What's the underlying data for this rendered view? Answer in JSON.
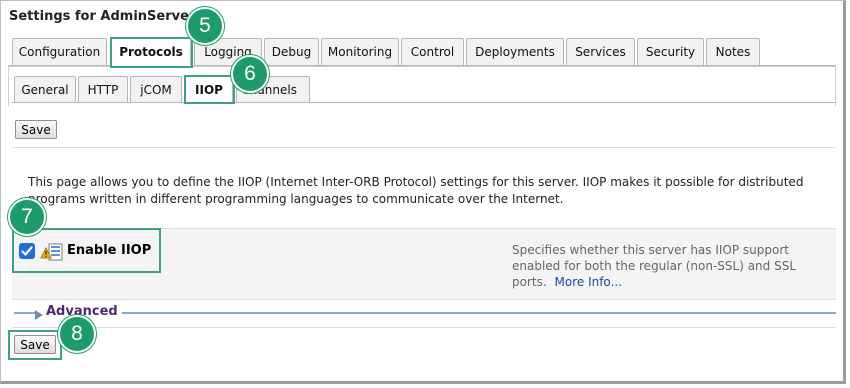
{
  "window": {
    "title": "Settings for AdminServer"
  },
  "main_tabs": [
    {
      "label": "Configuration"
    },
    {
      "label": "Protocols"
    },
    {
      "label": "Logging"
    },
    {
      "label": "Debug"
    },
    {
      "label": "Monitoring"
    },
    {
      "label": "Control"
    },
    {
      "label": "Deployments"
    },
    {
      "label": "Services"
    },
    {
      "label": "Security"
    },
    {
      "label": "Notes"
    }
  ],
  "sub_tabs": [
    {
      "label": "General"
    },
    {
      "label": "HTTP"
    },
    {
      "label": "jCOM"
    },
    {
      "label": "IIOP"
    },
    {
      "label": "Channels"
    }
  ],
  "active_main_tab": "Protocols",
  "active_sub_tab": "IIOP",
  "toolbar": {
    "save_label": "Save"
  },
  "description": "This page allows you to define the IIOP (Internet Inter-ORB Protocol) settings for this server. IIOP makes it possible for distributed programs written in different programming languages to communicate over the Internet.",
  "setting": {
    "label": "Enable IIOP",
    "checked": true,
    "help": "Specifies whether this server has IIOP support enabled for both the regular (non-SSL) and SSL ports.",
    "more_info": "More Info..."
  },
  "advanced": {
    "label": "Advanced"
  },
  "footer": {
    "save_label": "Save"
  },
  "callouts": [
    "5",
    "6",
    "7",
    "8"
  ],
  "colors": {
    "callout": "#1e9b6b",
    "checkbox": "#1f6fd6",
    "advanced_text": "#4b2a6e"
  }
}
